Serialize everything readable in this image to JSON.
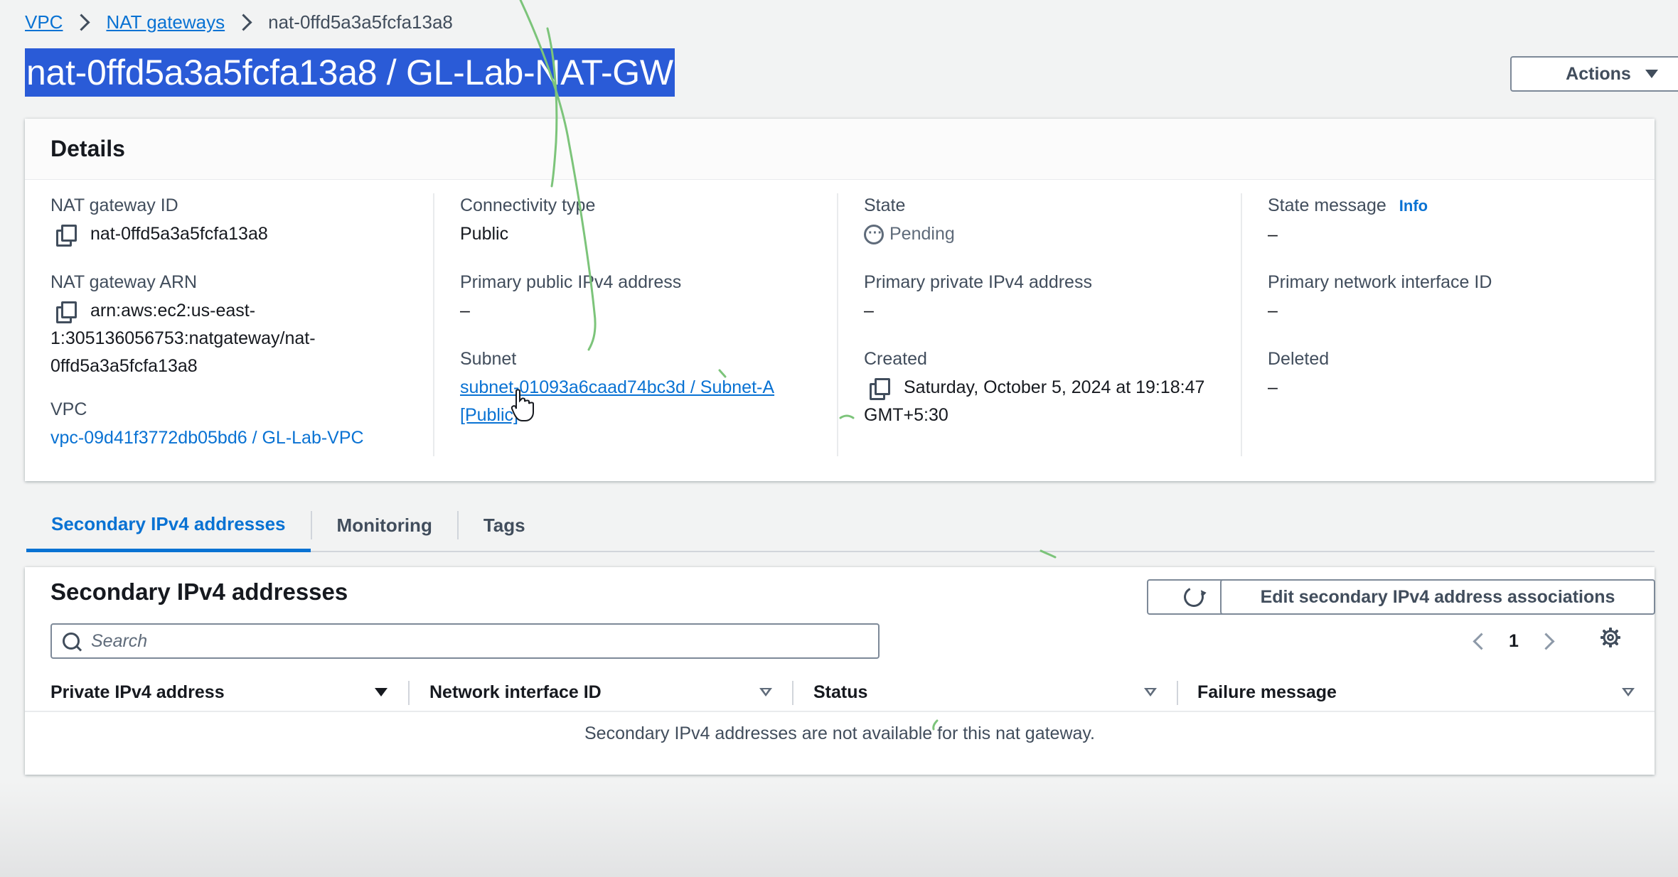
{
  "breadcrumb": {
    "items": [
      "VPC",
      "NAT gateways"
    ],
    "current": "nat-0ffd5a3a5fcfa13a8"
  },
  "header": {
    "title": "nat-0ffd5a3a5fcfa13a8 / GL-Lab-NAT-GW",
    "actions_label": "Actions"
  },
  "details": {
    "heading": "Details",
    "nat_gateway_id": {
      "label": "NAT gateway ID",
      "value": "nat-0ffd5a3a5fcfa13a8"
    },
    "nat_gateway_arn": {
      "label": "NAT gateway ARN",
      "value_line1": "arn:aws:ec2:us-east-",
      "value_line2": "1:305136056753:natgateway/nat-",
      "value_line3": "0ffd5a3a5fcfa13a8"
    },
    "vpc": {
      "label": "VPC",
      "value": "vpc-09d41f3772db05bd6 / GL-Lab-VPC"
    },
    "connectivity_type": {
      "label": "Connectivity type",
      "value": "Public"
    },
    "primary_public_ipv4": {
      "label": "Primary public IPv4 address",
      "value": "–"
    },
    "subnet": {
      "label": "Subnet",
      "value_line1": "subnet-01093a6caad74bc3d / Subnet-A",
      "value_line2": "[Public]"
    },
    "state": {
      "label": "State",
      "value": "Pending"
    },
    "primary_private_ipv4": {
      "label": "Primary private IPv4 address",
      "value": "–"
    },
    "created": {
      "label": "Created",
      "value_line1": "Saturday, October 5, 2024 at 19:18:47",
      "value_line2": "GMT+5:30"
    },
    "state_message": {
      "label": "State message",
      "info": "Info",
      "value": "–"
    },
    "primary_network_interface_id": {
      "label": "Primary network interface ID",
      "value": "–"
    },
    "deleted": {
      "label": "Deleted",
      "value": "–"
    }
  },
  "tabs": [
    {
      "label": "Secondary IPv4 addresses",
      "active": true
    },
    {
      "label": "Monitoring",
      "active": false
    },
    {
      "label": "Tags",
      "active": false
    }
  ],
  "secondary_panel": {
    "title": "Secondary IPv4 addresses",
    "edit_label": "Edit secondary IPv4 address associations",
    "search_placeholder": "Search",
    "page": "1",
    "columns": [
      "Private IPv4 address",
      "Network interface ID",
      "Status",
      "Failure message"
    ],
    "empty_message": "Secondary IPv4 addresses are not available for this nat gateway."
  },
  "icons": [
    "copy-icon",
    "pending-icon",
    "refresh-icon",
    "search-icon",
    "settings-gear-icon",
    "caret-down-icon",
    "chevron-left-icon",
    "chevron-right-icon",
    "cursor-hand-icon"
  ],
  "colors": {
    "link": "#0972d3",
    "title_selection": "#2a5bd7",
    "annotation_stroke": "#7cc47a"
  }
}
